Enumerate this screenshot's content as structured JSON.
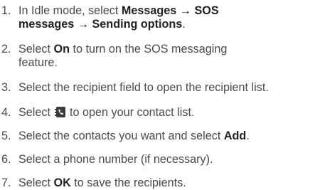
{
  "steps": [
    {
      "number": "1.",
      "line1_pre": "In Idle mode, select ",
      "line1_bold": "Messages",
      "arrow1": " → ",
      "line1_bold2": "SOS",
      "line2_bold": "messages",
      "arrow2": " → ",
      "line2_bold2": "Sending options",
      "line2_post": "."
    },
    {
      "number": "2.",
      "pre": "Select ",
      "bold": "On",
      "post": " to turn on the SOS messaging",
      "line2": "feature."
    },
    {
      "number": "3.",
      "text": "Select the recipient field to open the recipient list."
    },
    {
      "number": "4.",
      "pre": "Select ",
      "icon": "contacts-phonebook-icon",
      "post": " to open your contact list."
    },
    {
      "number": "5.",
      "pre": "Select the contacts you want and select ",
      "bold": "Add",
      "post": "."
    },
    {
      "number": "6.",
      "text": "Select a phone number (if necessary)."
    },
    {
      "number": "7.",
      "pre": "Select ",
      "bold": "OK",
      "post": " to save the recipients."
    }
  ]
}
